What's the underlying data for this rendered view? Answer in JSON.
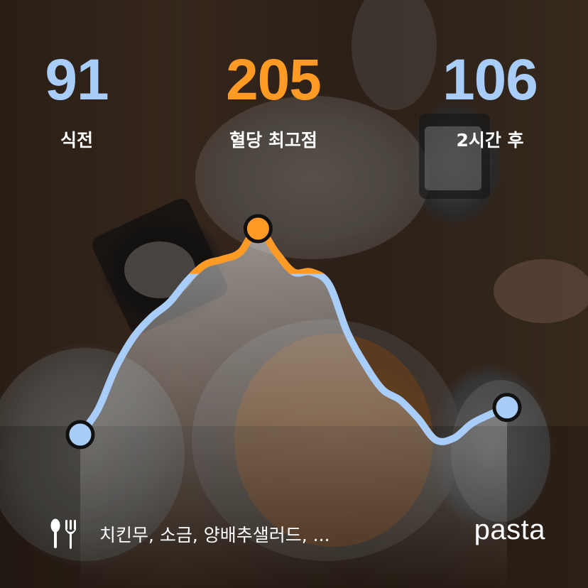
{
  "stats": {
    "before": {
      "value": "91",
      "label": "식전"
    },
    "peak": {
      "value": "205",
      "label": "혈당 최고점"
    },
    "after": {
      "value": "106",
      "label": "2시간 후"
    }
  },
  "chart_data": {
    "type": "line",
    "title": "",
    "xlabel": "",
    "ylabel": "",
    "ylim": [
      60,
      230
    ],
    "xlim": [
      0,
      120
    ],
    "series": [
      {
        "x": [
          0,
          5,
          10,
          15,
          20,
          25,
          30,
          35,
          40,
          45,
          50,
          55,
          60,
          65,
          70,
          75,
          80,
          85,
          90,
          95,
          100,
          105,
          110,
          115,
          120
        ],
        "values": [
          91,
          105,
          128,
          145,
          156,
          164,
          176,
          185,
          188,
          192,
          205,
          192,
          181,
          181,
          174,
          148,
          130,
          116,
          110,
          100,
          88,
          89,
          97,
          102,
          106
        ]
      }
    ],
    "highlight_threshold": 180,
    "markers": {
      "start": 91,
      "peak": 205,
      "end": 106
    },
    "colors": {
      "line": "#a8cdf8",
      "above_threshold": "#ff9a25",
      "marker_stroke": "#111111"
    }
  },
  "foods": {
    "icon": "fork-knife-icon",
    "text": "치킨무, 소금, 양배추샐러드, ..."
  },
  "brand": {
    "name": "pasta"
  }
}
